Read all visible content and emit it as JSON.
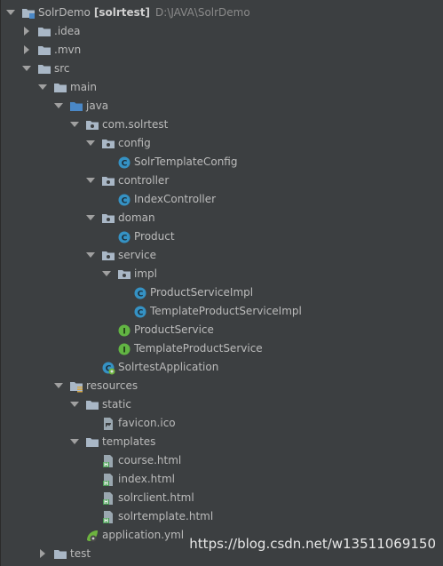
{
  "project": {
    "name": "SolrDemo",
    "module": "[solrtest]",
    "path": "D:\\JAVA\\SolrDemo"
  },
  "tree": [
    {
      "label": "SolrDemo",
      "icon": "module-folder-icon",
      "expanded": true,
      "depth": 0
    },
    {
      "label": ".idea",
      "icon": "folder-icon",
      "expanded": false,
      "depth": 1
    },
    {
      "label": ".mvn",
      "icon": "folder-icon",
      "expanded": false,
      "depth": 1
    },
    {
      "label": "src",
      "icon": "folder-icon",
      "expanded": true,
      "depth": 1
    },
    {
      "label": "main",
      "icon": "folder-icon",
      "expanded": true,
      "depth": 2
    },
    {
      "label": "java",
      "icon": "source-folder-icon",
      "expanded": true,
      "depth": 3
    },
    {
      "label": "com.solrtest",
      "icon": "package-icon",
      "expanded": true,
      "depth": 4
    },
    {
      "label": "config",
      "icon": "package-icon",
      "expanded": true,
      "depth": 5
    },
    {
      "label": "SolrTemplateConfig",
      "icon": "class-icon",
      "depth": 6
    },
    {
      "label": "controller",
      "icon": "package-icon",
      "expanded": true,
      "depth": 5
    },
    {
      "label": "IndexController",
      "icon": "class-icon",
      "depth": 6
    },
    {
      "label": "doman",
      "icon": "package-icon",
      "expanded": true,
      "depth": 5
    },
    {
      "label": "Product",
      "icon": "class-icon",
      "depth": 6
    },
    {
      "label": "service",
      "icon": "package-icon",
      "expanded": true,
      "depth": 5
    },
    {
      "label": "impl",
      "icon": "package-icon",
      "expanded": true,
      "depth": 6
    },
    {
      "label": "ProductServiceImpl",
      "icon": "class-icon",
      "depth": 7
    },
    {
      "label": "TemplateProductServiceImpl",
      "icon": "class-icon",
      "depth": 7
    },
    {
      "label": "ProductService",
      "icon": "interface-icon",
      "depth": 6
    },
    {
      "label": "TemplateProductService",
      "icon": "interface-icon",
      "depth": 6
    },
    {
      "label": "SolrtestApplication",
      "icon": "spring-boot-class-icon",
      "depth": 5
    },
    {
      "label": "resources",
      "icon": "resources-folder-icon",
      "expanded": true,
      "depth": 3
    },
    {
      "label": "static",
      "icon": "folder-icon",
      "expanded": true,
      "depth": 4
    },
    {
      "label": "favicon.ico",
      "icon": "image-file-icon",
      "depth": 5
    },
    {
      "label": "templates",
      "icon": "folder-icon",
      "expanded": true,
      "depth": 4
    },
    {
      "label": "course.html",
      "icon": "html-file-icon",
      "depth": 5
    },
    {
      "label": "index.html",
      "icon": "html-file-icon",
      "depth": 5
    },
    {
      "label": "solrclient.html",
      "icon": "html-file-icon",
      "depth": 5
    },
    {
      "label": "solrtemplate.html",
      "icon": "html-file-icon",
      "depth": 5
    },
    {
      "label": "application.yml",
      "icon": "spring-config-file-icon",
      "depth": 4
    },
    {
      "label": "test",
      "icon": "folder-icon",
      "expanded": false,
      "depth": 2
    }
  ],
  "watermark": "https://blog.csdn.net/w13511069150",
  "colors": {
    "background": "#3c3f41",
    "text": "#bbbbbb",
    "folder": "#a9b7c6",
    "source_folder": "#4a88c7",
    "class": "#3592c4",
    "interface": "#62b543",
    "html": "#499c54"
  }
}
